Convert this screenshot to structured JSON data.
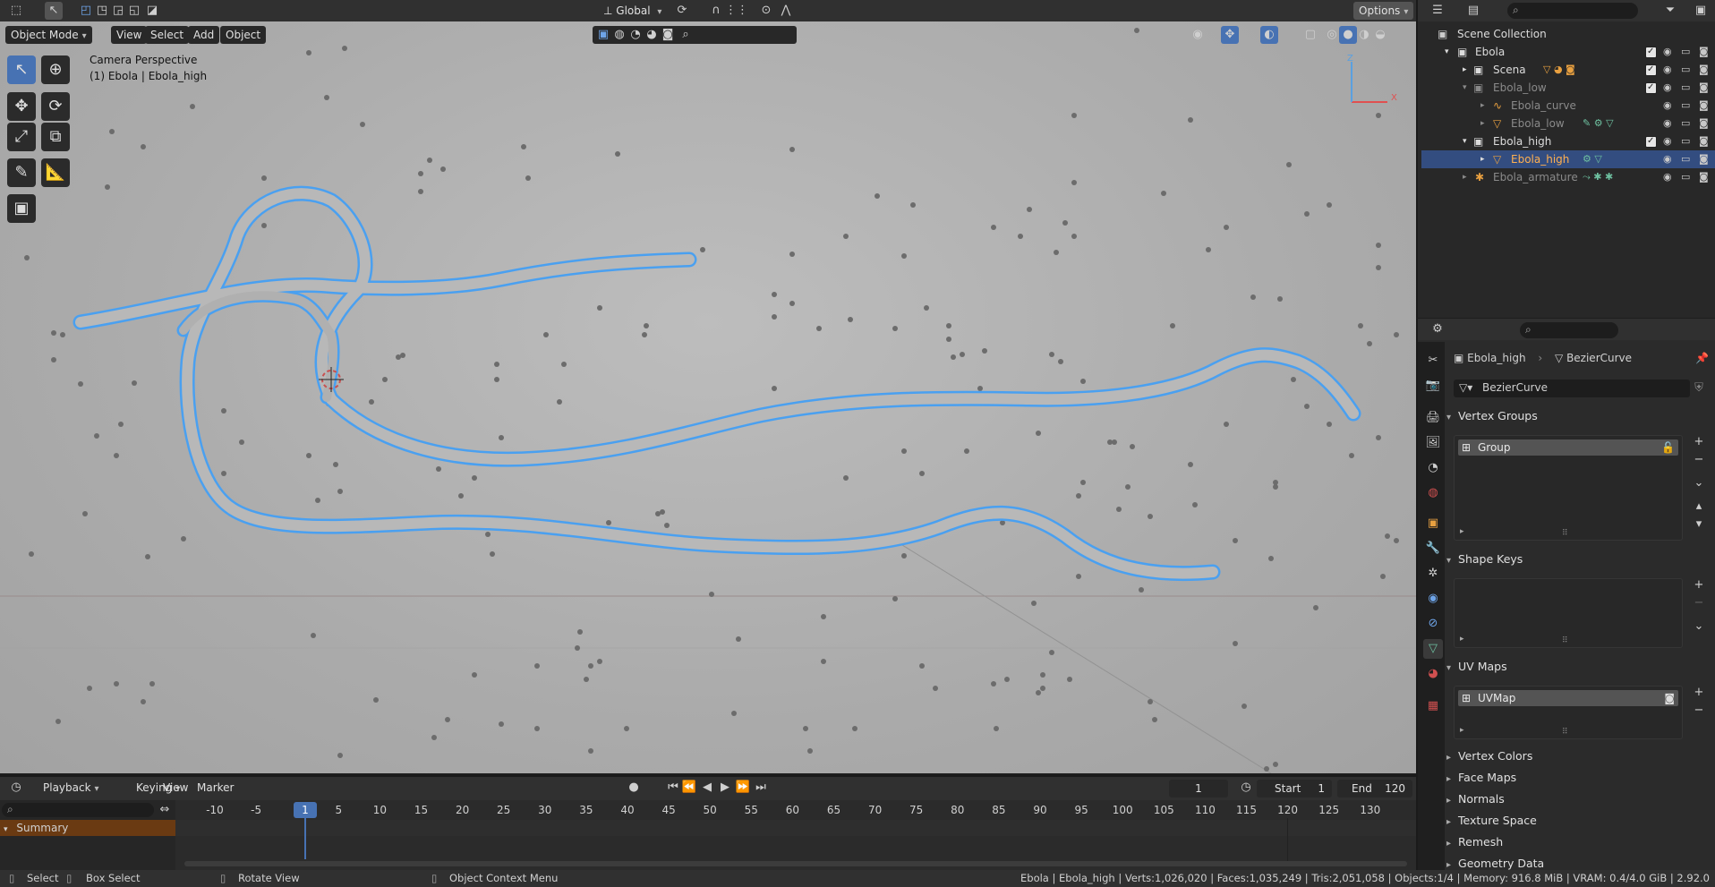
{
  "topbar": {
    "transform_orientation": "Global",
    "options_label": "Options"
  },
  "viewport_header": {
    "mode": "Object Mode",
    "menus": [
      "View",
      "Select",
      "Add",
      "Object"
    ]
  },
  "viewport": {
    "camera_label": "Camera Perspective",
    "object_label": "(1) Ebola | Ebola_high",
    "axis_x": "X",
    "axis_z": "Z"
  },
  "outliner": {
    "rows": [
      {
        "label": "Scene Collection"
      },
      {
        "label": "Ebola"
      },
      {
        "label": "Scena"
      },
      {
        "label": "Ebola_low"
      },
      {
        "label": "Ebola_curve"
      },
      {
        "label": "Ebola_low"
      },
      {
        "label": "Ebola_high"
      },
      {
        "label": "Ebola_high"
      },
      {
        "label": "Ebola_armature"
      }
    ]
  },
  "properties": {
    "breadcrumb_object": "Ebola_high",
    "breadcrumb_data": "BezierCurve",
    "data_name": "BezierCurve",
    "panels": {
      "vertex_groups": "Vertex Groups",
      "shape_keys": "Shape Keys",
      "uv_maps": "UV Maps",
      "vertex_colors": "Vertex Colors",
      "face_maps": "Face Maps",
      "normals": "Normals",
      "texture_space": "Texture Space",
      "remesh": "Remesh",
      "geometry_data": "Geometry Data"
    },
    "vertex_group_item": "Group",
    "uv_map_item": "UVMap"
  },
  "timeline": {
    "menus": [
      "Playback",
      "Keying",
      "View",
      "Marker"
    ],
    "current_frame": "1",
    "start_label": "Start",
    "start_value": "1",
    "end_label": "End",
    "end_value": "120",
    "ticks": [
      "-10",
      "-5",
      "1",
      "5",
      "10",
      "15",
      "20",
      "25",
      "30",
      "35",
      "40",
      "45",
      "50",
      "55",
      "60",
      "65",
      "70",
      "75",
      "80",
      "85",
      "90",
      "95",
      "100",
      "105",
      "110",
      "115",
      "120",
      "125",
      "130"
    ],
    "summary_label": "Summary"
  },
  "statusbar": {
    "select": "Select",
    "box_select": "Box Select",
    "rotate_view": "Rotate View",
    "context_menu": "Object Context Menu",
    "stats": "Ebola | Ebola_high | Verts:1,026,020 | Faces:1,035,249 | Tris:2,051,058 | Objects:1/4 | Memory: 916.8 MiB | VRAM: 0.4/4.0 GiB | 2.92.0"
  },
  "colors": {
    "selection_outline": "#4aa0f0",
    "accent_blue": "#4772b3",
    "frame_marker": "#4772b3",
    "summary_bg": "#6a3a12"
  }
}
